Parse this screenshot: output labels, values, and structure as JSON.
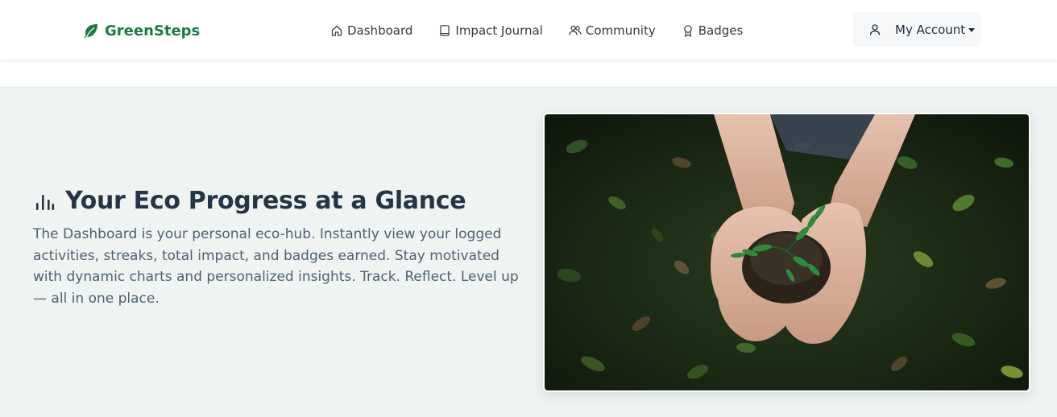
{
  "brand": {
    "name": "GreenSteps",
    "icon": "leaf-icon",
    "color": "#1d7a46"
  },
  "nav": {
    "items": [
      {
        "label": "Dashboard",
        "icon": "home-icon"
      },
      {
        "label": "Impact Journal",
        "icon": "book-icon"
      },
      {
        "label": "Community",
        "icon": "people-icon"
      },
      {
        "label": "Badges",
        "icon": "award-icon"
      }
    ]
  },
  "account": {
    "label": "My Account",
    "icon": "person-icon"
  },
  "hero": {
    "title": "Your Eco Progress at a Glance",
    "title_icon": "bar-chart-icon",
    "description": "The Dashboard is your personal eco-hub. Instantly view your logged activities, streaks, total impact, and badges earned. Stay motivated with dynamic charts and personalized insights. Track. Reflect. Level up — all in one place.",
    "image": "hands-holding-seedling-image",
    "background": "#eff4f3"
  }
}
